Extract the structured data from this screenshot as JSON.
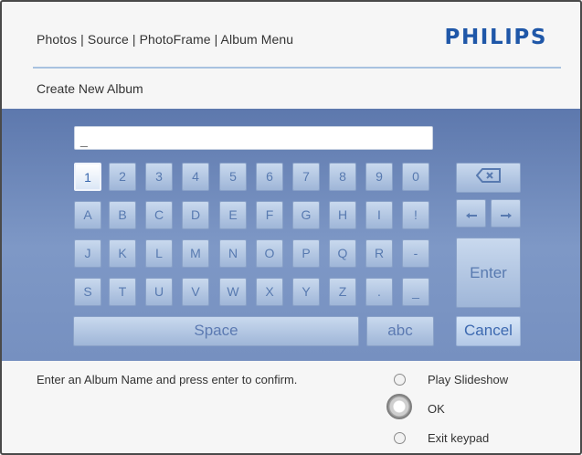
{
  "header": {
    "breadcrumb": "Photos | Source | PhotoFrame | Album Menu",
    "logo": "PHILIPS",
    "subtitle": "Create New Album"
  },
  "input": {
    "value": "_"
  },
  "keyboard": {
    "rows": [
      [
        "1",
        "2",
        "3",
        "4",
        "5",
        "6",
        "7",
        "8",
        "9",
        "0"
      ],
      [
        "A",
        "B",
        "C",
        "D",
        "E",
        "F",
        "G",
        "H",
        "I",
        "!"
      ],
      [
        "J",
        "K",
        "L",
        "M",
        "N",
        "O",
        "P",
        "Q",
        "R",
        "-"
      ],
      [
        "S",
        "T",
        "U",
        "V",
        "W",
        "X",
        "Y",
        "Z",
        ".",
        "_"
      ]
    ],
    "space": "Space",
    "abc": "abc",
    "enter": "Enter",
    "cancel": "Cancel",
    "backspace_icon": "backspace-icon",
    "left_arrow_icon": "arrow-left-icon",
    "right_arrow_icon": "arrow-right-icon"
  },
  "footer": {
    "instruction": "Enter an Album Name and press enter to confirm.",
    "options": [
      {
        "label": "Play Slideshow"
      },
      {
        "label": "OK"
      },
      {
        "label": "Exit keypad"
      }
    ]
  },
  "colors": {
    "brand": "#1f57a8",
    "keyboard_bg": "#6f89bb",
    "key_fill": "#b6c8e2",
    "text": "#333333"
  }
}
